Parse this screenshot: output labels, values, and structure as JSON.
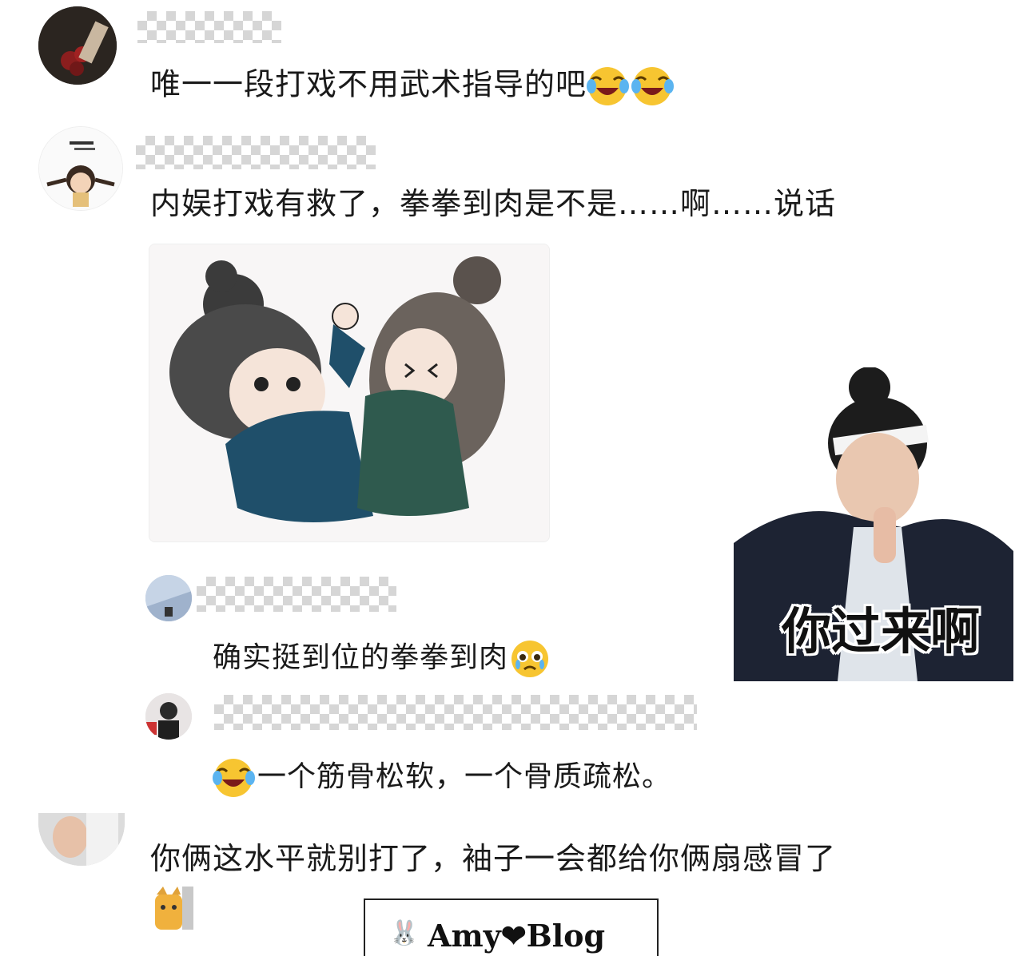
{
  "comments": [
    {
      "text": "唯一一段打戏不用武术指导的吧"
    },
    {
      "text": "内娱打戏有救了，拳拳到肉是不是……啊……说话"
    },
    {
      "text": "你俩这水平就别打了，袖子一会都给你俩扇感冒了"
    }
  ],
  "replies": [
    {
      "text": "确实挺到位的拳拳到肉"
    },
    {
      "text": "一个筋骨松软，一个骨质疏松。"
    }
  ],
  "sticker": {
    "caption": "你过来啊"
  },
  "watermark": {
    "text": "Amy❤Blog"
  },
  "colors": {
    "text": "#1a1a1a",
    "mask": "#d6d6d6",
    "teal_robe": "#1f4f6a"
  }
}
